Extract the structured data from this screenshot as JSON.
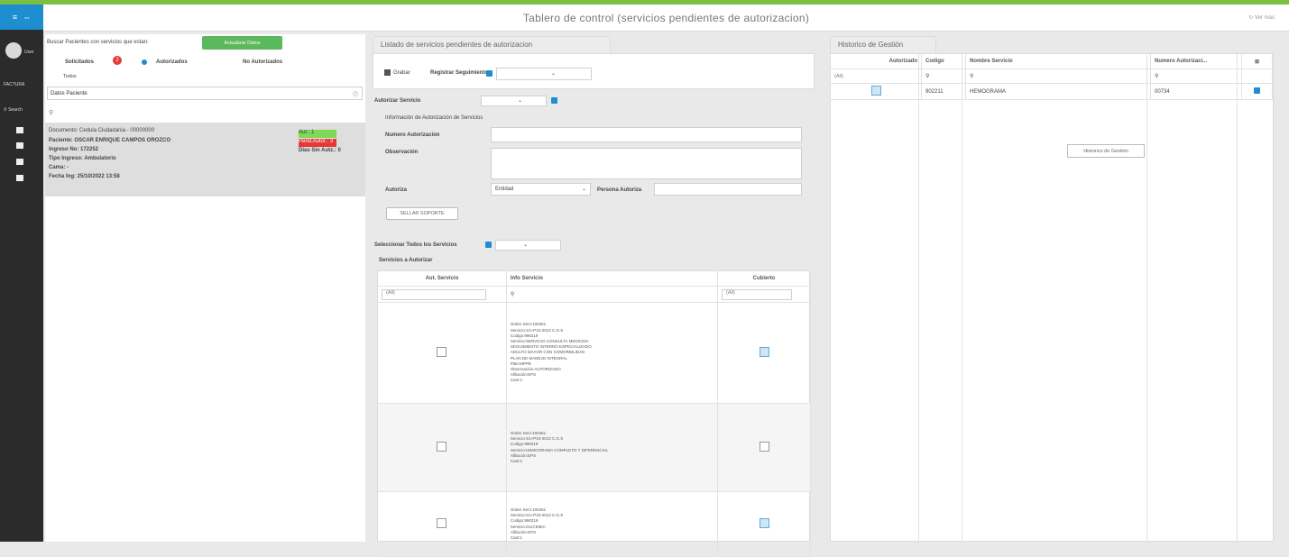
{
  "header": {
    "title": "Tablero de control (servicios pendientes de autorizacion)",
    "top_right": "Ver más"
  },
  "rail": {
    "user_label": "User",
    "app_label": "FACTURA",
    "search_placeholder": "Search"
  },
  "left": {
    "search_label": "Buscar Pacientes con servicios que estan:",
    "update_button": "Actualizar Datos",
    "radio_options": [
      "Solicitados",
      "Autorizados",
      "No Autorizados"
    ],
    "badge_count": "2",
    "all_label": "Todos",
    "patient_section_label": "Datos Paciente",
    "patient": {
      "documento": "Documento: Cedula Ciudadania - 00000000",
      "paciente": "Paciente: OSCAR ENRIQUE CAMPOS OROZCO",
      "ingreso": "Ingreso No: 172252",
      "tipo_ingreso": "Tipo Ingreso: Ambulatorio",
      "cama": "Cama: -",
      "fecha": "Fecha Ing: 25/10/2022 13:58"
    },
    "status_badges": {
      "green": "Aut.: 1",
      "red": "Pend.Autor.: 3",
      "days": "Días Sin Autz.: 0"
    }
  },
  "middle": {
    "tab": "Listado de servicios pendientes de autorizacion",
    "save_label": "Grabar",
    "register_label": "Registrar Seguimiento",
    "authorize_label": "Autorizar Servicio",
    "info_title": "Información de Autorización de Servicios",
    "fields": {
      "numero": "Numero Autorizacion",
      "observacion": "Observación",
      "autoriza": "Autoriza",
      "autoriza_value": "Entidad",
      "persona": "Persona Autoriza"
    },
    "support_button": "SELLAR SOPORTE",
    "select_all_label": "Seleccionar Todos los Servicios",
    "services_title": "Servicios a Autorizar",
    "table": {
      "headers": [
        "Aut. Servicio",
        "Info Servicio",
        "Cubierto"
      ],
      "filter_all": "(All)",
      "rows": [
        {
          "lines": [
            "Orden Serv:100461",
            "Servicio:S1+P10-2013 C.G.S",
            "Codigo:990219",
            "Servicio:SERVICIO CONSULTA MEDICINA",
            "SEGUIMIENTO INTERNO ESPECIALIZADO",
            "ADULTO MAYOR CON COMORBILIDAD",
            "PLAN DE MANEJO INTEGRAL",
            "Plan:MPPE",
            "Observación:AUTORIZADO",
            "Afiliación:EPS",
            "Cant:1"
          ],
          "checked": false,
          "covered": true
        },
        {
          "lines": [
            "Orden Serv:100461",
            "Servicio:S1+P10-2013 C.G.S",
            "Codigo:990219",
            "Servicio:HEMOGRAMA COMPLETO Y DIFERENCIAL",
            "Afiliación:EPS",
            "Cant:1"
          ],
          "checked": false,
          "covered": false
        },
        {
          "lines": [
            "Orden Serv:100461",
            "Servicio:S1+P10-2013 C.G.S",
            "Codigo:990219",
            "Servicio:GLICEMIA",
            "Afiliación:EPS",
            "Cant:1"
          ],
          "checked": false,
          "covered": true
        }
      ]
    }
  },
  "right": {
    "tab": "Historico de Gestión",
    "table": {
      "headers": [
        "Autorizado",
        "Codigo",
        "Nombre Servicio",
        "Numero Autorizaci..."
      ],
      "filter_all": "(All)",
      "row": {
        "codigo": "902211",
        "nombre": "HEMOGRAMA",
        "numero": "00734"
      }
    },
    "tooltip": "Historico de Gestión"
  },
  "colors": {
    "accent": "#1e8ed1",
    "green": "#5cb85c",
    "red": "#e53935",
    "topbar": "#7ac142"
  }
}
